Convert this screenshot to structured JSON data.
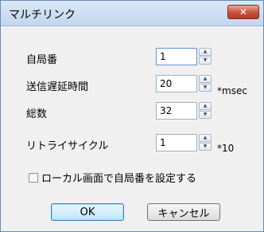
{
  "window": {
    "title": "マルチリンク",
    "close_label": "✕"
  },
  "fields": [
    {
      "label": "自局番",
      "value": "1",
      "unit": ""
    },
    {
      "label": "送信遅延時間",
      "value": "20",
      "unit": "*msec"
    },
    {
      "label": "総数",
      "value": "32",
      "unit": ""
    },
    {
      "label": "リトライサイクル",
      "value": "1",
      "unit": "*10"
    }
  ],
  "checkbox": {
    "label": "ローカル画面で自局番を設定する",
    "checked": false
  },
  "buttons": {
    "ok": "OK",
    "cancel": "キャンセル"
  }
}
